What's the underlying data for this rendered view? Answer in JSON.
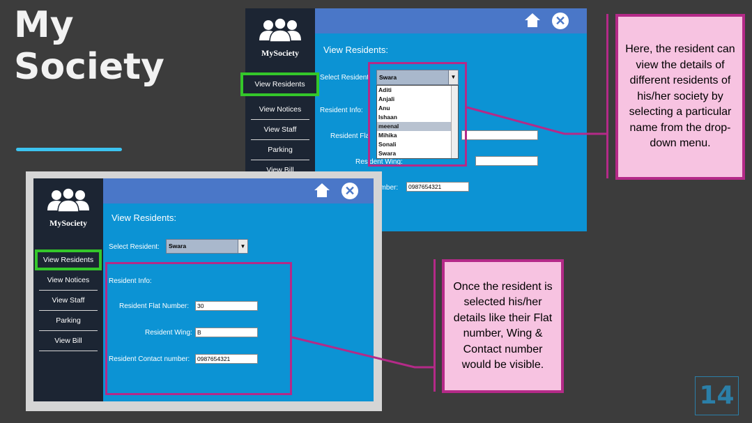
{
  "slide": {
    "title_line1": "My",
    "title_line2": "Society",
    "page_number": "14"
  },
  "app": {
    "brand": "MySociety",
    "nav": [
      "View Residents",
      "View Notices",
      "View Staff",
      "Parking",
      "View Bill"
    ],
    "section_title": "View Residents:",
    "select_label": "Select Resident:",
    "selected_resident": "Swara",
    "resident_info_label": "Resident Info:",
    "flat_label": "Resident Flat Number:",
    "flat_value": "30",
    "wing_label": "Resident Wing:",
    "wing_value": "B",
    "contact_label": "Resident Contact number:",
    "contact_value": "0987654321",
    "dropdown_options": [
      "Aditi",
      "Anjali",
      "Anu",
      "Ishaan",
      "meenal",
      "Mihika",
      "Sonali",
      "Swara"
    ],
    "dropdown_highlighted": "meenal",
    "top_partial_labels": {
      "select": "Select Resident",
      "flat": "Resident Fla",
      "wing": "Resident Wing:",
      "contact": "umber:"
    }
  },
  "callouts": {
    "top": "Here, the resident can view the details of different residents of his/her society by selecting a particular name from the drop-down menu.",
    "bottom": "Once the resident is selected his/her details like their Flat number, Wing & Contact number would be visible."
  },
  "colors": {
    "background": "#3c3c3c",
    "sidebar": "#1c2533",
    "main": "#0c93d4",
    "topbar": "#4a77c8",
    "highlight_green": "#34c72a",
    "callout_border": "#b42a88",
    "callout_fill": "#f7c3e1"
  }
}
